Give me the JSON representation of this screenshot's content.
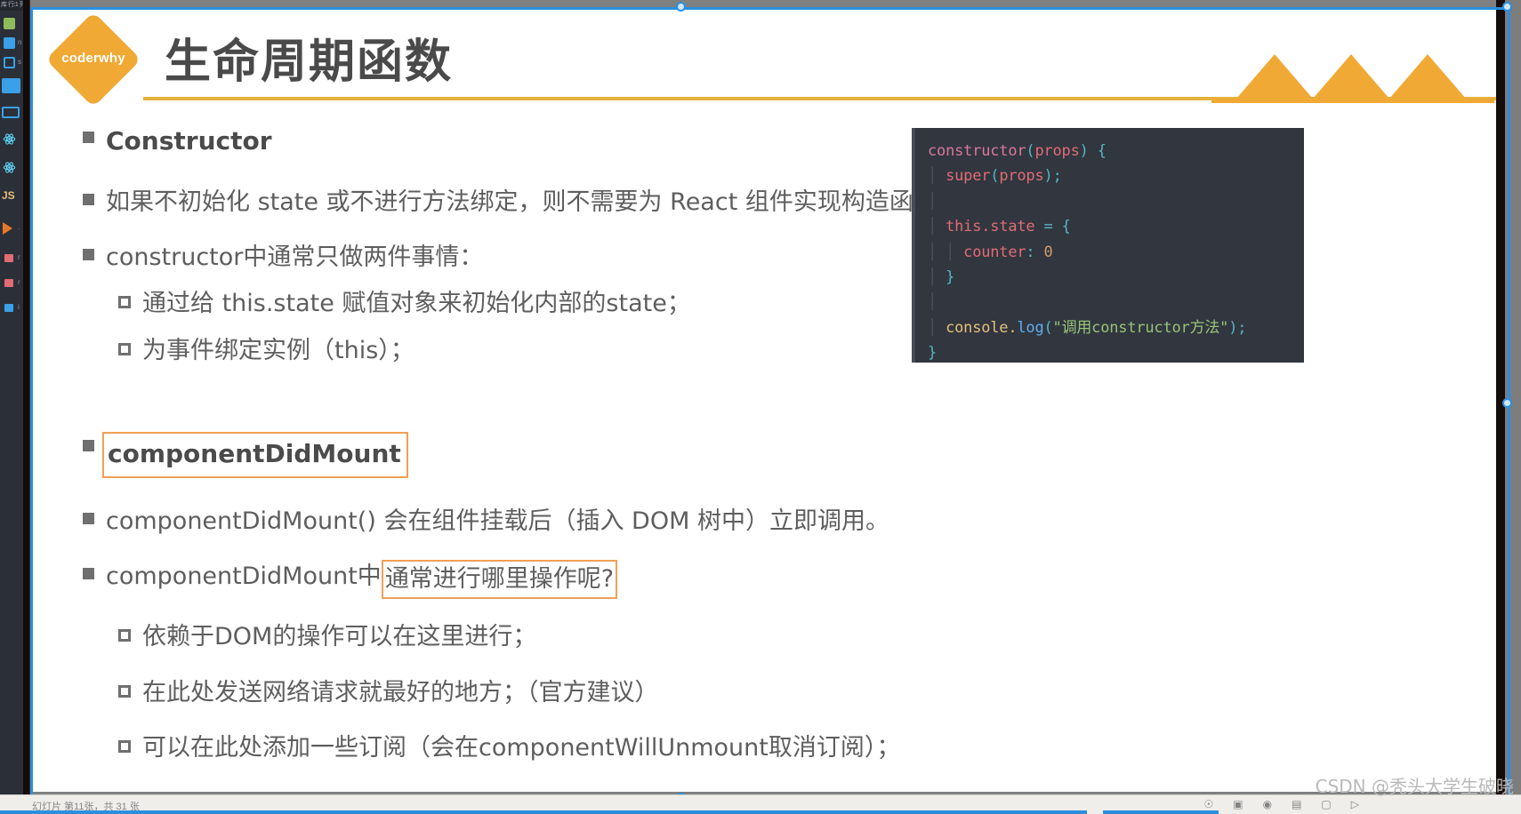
{
  "window": {
    "editor_tab_label": "库 行:1 列"
  },
  "sidebar": {
    "items": [
      {
        "name": "folder-icon",
        "label": "",
        "color": "#8fbc5a",
        "kind": "folder"
      },
      {
        "name": "folder-icon",
        "label": "n",
        "color": "#3aa0e8",
        "kind": "folder"
      },
      {
        "name": "file-icon",
        "label": "s",
        "color": "#3aa0e8",
        "kind": "hollow"
      },
      {
        "name": "folder-open-icon",
        "label": "",
        "color": "#3aa0e8",
        "kind": "folder"
      },
      {
        "name": "folder-icon",
        "label": "",
        "color": "#3aa0e8",
        "kind": "hollow"
      },
      {
        "name": "react-icon",
        "label": "",
        "color": "#61dafb",
        "kind": "react"
      },
      {
        "name": "react-icon",
        "label": "",
        "color": "#61dafb",
        "kind": "react"
      },
      {
        "name": "javascript-icon",
        "label": "",
        "color": "#e6c07b",
        "kind": "js"
      },
      {
        "name": "play-icon",
        "label": ".",
        "color": "#e8762a",
        "kind": "triangle"
      },
      {
        "name": "file-icon",
        "label": "r",
        "color": "#e06c75",
        "kind": "file"
      },
      {
        "name": "file-icon",
        "label": "r",
        "color": "#e06c75",
        "kind": "file"
      },
      {
        "name": "file-icon",
        "label": "i",
        "color": "#3aa0e8",
        "kind": "file"
      }
    ]
  },
  "slide": {
    "logo_text": "coderwhy",
    "title": "生命周期函数",
    "accent_color": "#f0a934",
    "highlight_color": "#f0a058",
    "bullets": [
      {
        "level": 1,
        "text": "Constructor",
        "style": "bold",
        "highlight": "none"
      },
      {
        "level": 1,
        "text": "如果不初始化 state 或不进行方法绑定，则不需要为 React 组件实现构造函数。",
        "style": "normal",
        "highlight": "none"
      },
      {
        "level": 1,
        "text": "constructor中通常只做两件事情：",
        "style": "normal",
        "highlight": "none"
      },
      {
        "level": 2,
        "text": "通过给 this.state 赋值对象来初始化内部的state；",
        "style": "normal",
        "highlight": "none"
      },
      {
        "level": 2,
        "text": "为事件绑定实例（this）；",
        "style": "normal",
        "highlight": "none"
      },
      {
        "level": 1,
        "text": "componentDidMount",
        "style": "bold",
        "highlight": "box"
      },
      {
        "level": 1,
        "text": "componentDidMount() 会在组件挂载后（插入 DOM 树中）立即调用。",
        "style": "normal",
        "highlight": "none"
      },
      {
        "level": 1,
        "text": "componentDidMount中",
        "style": "normal",
        "highlight": "partial",
        "text_highlighted": "通常进行哪里操作呢?"
      },
      {
        "level": 2,
        "text": "依赖于DOM的操作可以在这里进行；",
        "style": "normal",
        "highlight": "none"
      },
      {
        "level": 2,
        "text": "在此处发送网络请求就最好的地方；（官方建议）",
        "style": "normal",
        "highlight": "none"
      },
      {
        "level": 2,
        "text": "可以在此处添加一些订阅（会在componentWillUnmount取消订阅）；",
        "style": "normal",
        "highlight": "none"
      }
    ],
    "code": {
      "language": "javascript",
      "background": "#31363f",
      "lines": [
        "constructor(props) {",
        "  super(props);",
        "",
        "  this.state = {",
        "    counter: 0",
        "  }",
        "",
        "  console.log(\"调用constructor方法\");",
        "}"
      ],
      "tokens": {
        "l1_kw": "constructor",
        "l1_p1": "(",
        "l1_arg": "props",
        "l1_p2": ")",
        "l1_brace": "{",
        "l2_kw": "super",
        "l2_p1": "(",
        "l2_arg": "props",
        "l2_p2": ")",
        "l2_semi": ";",
        "l4_this": "this",
        "l4_dot": ".",
        "l4_state": "state",
        "l4_eq": "=",
        "l4_brace": "{",
        "l5_prop": "counter",
        "l5_colon": ":",
        "l5_val": "0",
        "l6_brace": "}",
        "l8_obj": "console",
        "l8_dot": ".",
        "l8_meth": "log",
        "l8_p1": "(",
        "l8_str": "\"调用constructor方法\"",
        "l8_p2": ")",
        "l8_semi": ";",
        "l9_brace": "}"
      }
    }
  },
  "status_bar": {
    "left_text": "幻灯片 第11张，共 31 张",
    "icons": [
      "notes-icon",
      "comments-icon",
      "normal-view-icon",
      "slide-sorter-icon",
      "reading-view-icon",
      "slideshow-icon"
    ]
  },
  "watermark": "CSDN @秃头大学生破晓"
}
